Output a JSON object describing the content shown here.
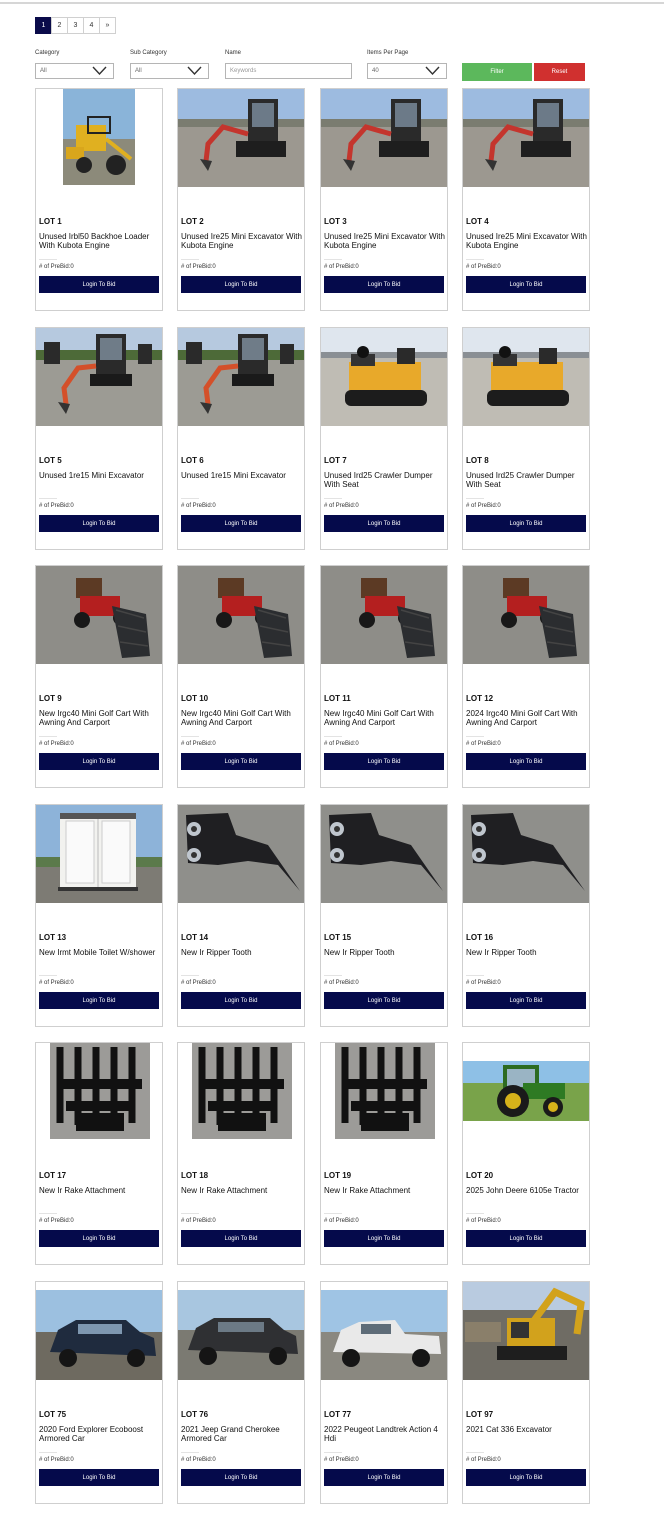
{
  "pagination": {
    "pages": [
      "1",
      "2",
      "3",
      "4",
      "»"
    ],
    "active_index": 0
  },
  "filters": {
    "category_label": "Category",
    "category_value": "All",
    "subcategory_label": "Sub Category",
    "subcategory_value": "All",
    "name_label": "Name",
    "name_placeholder": "Keywords",
    "items_per_page_label": "Items Per Page",
    "items_per_page_value": "40",
    "filter_button": "Filter",
    "reset_button": "Reset"
  },
  "colors": {
    "navy": "#050a4b",
    "filter_green": "#5cb85c",
    "reset_red": "#d0302f"
  },
  "prebid_label": "# of PreBid:0",
  "bid_button_label": "Login To Bid",
  "lots": [
    {
      "lot": "LOT 1",
      "title": "Unused Irbl50 Backhoe Loader With Kubota Engine",
      "image": "loader-photo"
    },
    {
      "lot": "LOT 2",
      "title": "Unused Ire25 Mini Excavator With Kubota Engine",
      "image": "mini-excavator-photo"
    },
    {
      "lot": "LOT 3",
      "title": "Unused Ire25 Mini Excavator With Kubota Engine",
      "image": "mini-excavator-photo"
    },
    {
      "lot": "LOT 4",
      "title": "Unused Ire25 Mini Excavator With Kubota Engine",
      "image": "mini-excavator-photo"
    },
    {
      "lot": "LOT 5",
      "title": "Unused 1re15 Mini Excavator",
      "image": "small-excavator-photo"
    },
    {
      "lot": "LOT 6",
      "title": "Unused 1re15 Mini Excavator",
      "image": "small-excavator-photo"
    },
    {
      "lot": "LOT 7",
      "title": "Unused Ird25 Crawler Dumper With Seat",
      "image": "crawler-dumper-photo"
    },
    {
      "lot": "LOT 8",
      "title": "Unused Ird25 Crawler Dumper With Seat",
      "image": "crawler-dumper-photo"
    },
    {
      "lot": "LOT 9",
      "title": "New Irgc40 Mini Golf Cart With Awning And Carport",
      "image": "golf-cart-photo"
    },
    {
      "lot": "LOT 10",
      "title": "New Irgc40 Mini Golf Cart With Awning And Carport",
      "image": "golf-cart-photo"
    },
    {
      "lot": "LOT 11",
      "title": "New Irgc40 Mini Golf Cart With Awning And Carport",
      "image": "golf-cart-photo"
    },
    {
      "lot": "LOT 12",
      "title": "2024 Irgc40 Mini Golf Cart With Awning And Carport",
      "image": "golf-cart-photo"
    },
    {
      "lot": "LOT 13",
      "title": "New Irmt Mobile Toilet W/shower",
      "image": "toilet-photo"
    },
    {
      "lot": "LOT 14",
      "title": "New Ir Ripper Tooth",
      "image": "ripper-photo"
    },
    {
      "lot": "LOT 15",
      "title": "New Ir Ripper Tooth",
      "image": "ripper-photo"
    },
    {
      "lot": "LOT 16",
      "title": "New Ir Ripper Tooth",
      "image": "ripper-photo"
    },
    {
      "lot": "LOT 17",
      "title": "New Ir Rake Attachment",
      "image": "rake-photo"
    },
    {
      "lot": "LOT 18",
      "title": "New Ir Rake Attachment",
      "image": "rake-photo"
    },
    {
      "lot": "LOT 19",
      "title": "New Ir Rake Attachment",
      "image": "rake-photo"
    },
    {
      "lot": "LOT 20",
      "title": "2025 John Deere 6105e Tractor",
      "image": "tractor-photo"
    },
    {
      "lot": "LOT 75",
      "title": "2020 Ford Explorer Ecoboost Armored Car",
      "image": "suv-photo"
    },
    {
      "lot": "LOT 76",
      "title": "2021 Jeep Grand Cherokee Armored Car",
      "image": "jeep-photo"
    },
    {
      "lot": "LOT 77",
      "title": "2022 Peugeot Landtrek Action 4 Hdi",
      "image": "pickup-photo"
    },
    {
      "lot": "LOT 97",
      "title": "2021 Cat 336 Excavator",
      "image": "excavator-photo"
    }
  ]
}
